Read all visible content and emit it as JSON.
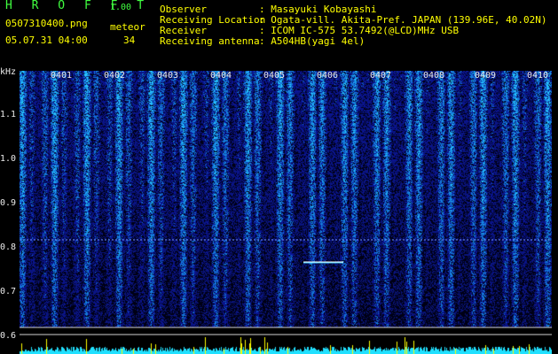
{
  "header": {
    "app_title": "H R O F F T",
    "version": "1.00",
    "filename": "0507310400.png",
    "datetime": "05.07.31 04:00",
    "meteor_label": "meteor",
    "meteor_count": "34",
    "info": [
      {
        "key": "Observer",
        "value": ": Masayuki Kobayashi"
      },
      {
        "key": "Receiving Location",
        "value": ": Ogata-vill. Akita-Pref. JAPAN (139.96E, 40.02N)"
      },
      {
        "key": "Receiver",
        "value": ": ICOM IC-575 53.7492(@LCD)MHz USB"
      },
      {
        "key": "Receiving antenna",
        "value": ": A504HB(yagi 4el)"
      }
    ]
  },
  "axis": {
    "unit": "kHz",
    "y_labels": [
      "1.1",
      "1.0",
      "0.9",
      "0.8",
      "0.7",
      "0.6"
    ],
    "time_labels": [
      "0401",
      "0402",
      "0403",
      "0404",
      "0405",
      "0406",
      "0407",
      "0408",
      "0409",
      "0410"
    ]
  },
  "colors": {
    "background": "#000000",
    "header_text": "#ffff00",
    "title_green": "#40ff40",
    "signal_blue": "#2060ff",
    "signal_cyan": "#40d0ff",
    "meteor_yellow": "#ffff00",
    "baseline_cyan": "#20e0ff"
  }
}
